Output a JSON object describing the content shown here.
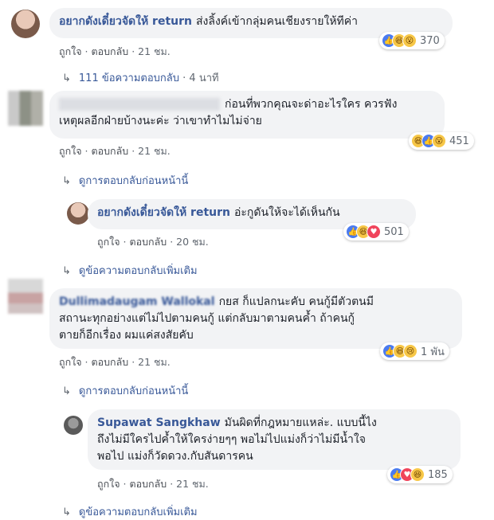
{
  "actions": {
    "like": "ถูกใจ",
    "reply": "ตอบกลับ"
  },
  "comments": [
    {
      "name": "อยากดังเดี๋ยวจัดให้ return",
      "text": "ส่งลิ้งค์เข้ากลุ่มคนเชียงรายให้ทีค่า",
      "time": "21 ชม.",
      "reactions": [
        "like-icon",
        "haha-icon",
        "wow-icon"
      ],
      "count": "370",
      "replies_link": "111 ข้อความตอบกลับ",
      "replies_time": "4 นาที"
    },
    {
      "name": "",
      "text_line1": "ก่อนที่พวกคุณจะด่าอะไรใคร ควรฟัง",
      "text_line2": "เหตุผลอีกฝ่ายบ้างนะค่ะ ว่าเขาทำไมไม่จ่าย",
      "time": "21 ชม.",
      "reactions": [
        "haha-icon",
        "like-icon",
        "wow-icon"
      ],
      "count": "451",
      "prev_replies": "ดูการตอบกลับก่อนหน้านี้"
    },
    {
      "name": "อยากดังเดี๋ยวจัดให้ return",
      "text": "อ่ะกูดันให้จะได้เห็นกัน",
      "time": "20 ชม.",
      "reactions": [
        "like-icon",
        "haha-icon",
        "love-icon"
      ],
      "count": "501",
      "more_replies": "ดูข้อความตอบกลับเพิ่มเติม"
    },
    {
      "name": "Dullimadaugam Wallokal",
      "text_line1": "กยส ก็แปลกนะคับ คนกู้มีตัวตนมี",
      "text_line2": "สถานะทุกอย่างแต่ไม่ไปตามคนกู้ แต่กลับมาตามคนค้ำ ถ้าคนกู้",
      "text_line3": "ตายก็อีกเรื่อง ผมแค่สงสัยคับ",
      "time": "21 ชม.",
      "reactions": [
        "like-icon",
        "haha-icon",
        "sad-icon"
      ],
      "count": "1 พัน",
      "prev_replies": "ดูการตอบกลับก่อนหน้านี้"
    },
    {
      "name": "Supawat Sangkhaw",
      "text_line1": "มันผิดที่กฎหมายแหล่ะ. แบบนี้ไง",
      "text_line2": "ถึงไม่มีใครไปค้ำให้ใครง่ายๆๆ พอไม่ไปแม่งก็ว่าไม่มีน้ำใจ",
      "text_line3": "พอไป แม่งก็วัดดวง.กับสันดารคน",
      "time": "21 ชม.",
      "reactions": [
        "like-icon",
        "love-icon",
        "haha-icon"
      ],
      "count": "185",
      "more_replies": "ดูข้อความตอบกลับเพิ่มเติม"
    }
  ],
  "icon_glyphs": {
    "like-icon": "👍",
    "haha-icon": "😆",
    "wow-icon": "😮",
    "love-icon": "♥",
    "sad-icon": "😢"
  },
  "colors": {
    "link": "#385898",
    "bubble": "#f2f3f5",
    "like": "#4a7bf0",
    "love": "#f0445b",
    "haha": "#f7c747"
  }
}
